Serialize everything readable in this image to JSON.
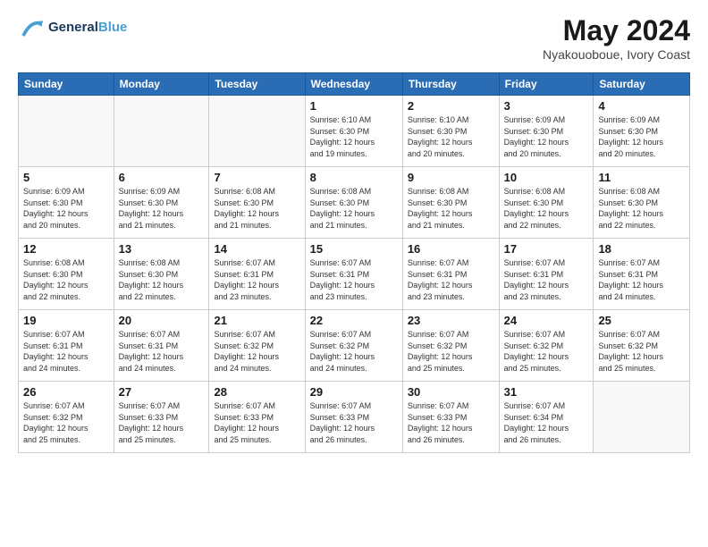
{
  "header": {
    "logo_line1": "General",
    "logo_line2": "Blue",
    "month_title": "May 2024",
    "location": "Nyakouoboue, Ivory Coast"
  },
  "weekdays": [
    "Sunday",
    "Monday",
    "Tuesday",
    "Wednesday",
    "Thursday",
    "Friday",
    "Saturday"
  ],
  "weeks": [
    [
      {
        "day": "",
        "info": ""
      },
      {
        "day": "",
        "info": ""
      },
      {
        "day": "",
        "info": ""
      },
      {
        "day": "1",
        "info": "Sunrise: 6:10 AM\nSunset: 6:30 PM\nDaylight: 12 hours\nand 19 minutes."
      },
      {
        "day": "2",
        "info": "Sunrise: 6:10 AM\nSunset: 6:30 PM\nDaylight: 12 hours\nand 20 minutes."
      },
      {
        "day": "3",
        "info": "Sunrise: 6:09 AM\nSunset: 6:30 PM\nDaylight: 12 hours\nand 20 minutes."
      },
      {
        "day": "4",
        "info": "Sunrise: 6:09 AM\nSunset: 6:30 PM\nDaylight: 12 hours\nand 20 minutes."
      }
    ],
    [
      {
        "day": "5",
        "info": "Sunrise: 6:09 AM\nSunset: 6:30 PM\nDaylight: 12 hours\nand 20 minutes."
      },
      {
        "day": "6",
        "info": "Sunrise: 6:09 AM\nSunset: 6:30 PM\nDaylight: 12 hours\nand 21 minutes."
      },
      {
        "day": "7",
        "info": "Sunrise: 6:08 AM\nSunset: 6:30 PM\nDaylight: 12 hours\nand 21 minutes."
      },
      {
        "day": "8",
        "info": "Sunrise: 6:08 AM\nSunset: 6:30 PM\nDaylight: 12 hours\nand 21 minutes."
      },
      {
        "day": "9",
        "info": "Sunrise: 6:08 AM\nSunset: 6:30 PM\nDaylight: 12 hours\nand 21 minutes."
      },
      {
        "day": "10",
        "info": "Sunrise: 6:08 AM\nSunset: 6:30 PM\nDaylight: 12 hours\nand 22 minutes."
      },
      {
        "day": "11",
        "info": "Sunrise: 6:08 AM\nSunset: 6:30 PM\nDaylight: 12 hours\nand 22 minutes."
      }
    ],
    [
      {
        "day": "12",
        "info": "Sunrise: 6:08 AM\nSunset: 6:30 PM\nDaylight: 12 hours\nand 22 minutes."
      },
      {
        "day": "13",
        "info": "Sunrise: 6:08 AM\nSunset: 6:30 PM\nDaylight: 12 hours\nand 22 minutes."
      },
      {
        "day": "14",
        "info": "Sunrise: 6:07 AM\nSunset: 6:31 PM\nDaylight: 12 hours\nand 23 minutes."
      },
      {
        "day": "15",
        "info": "Sunrise: 6:07 AM\nSunset: 6:31 PM\nDaylight: 12 hours\nand 23 minutes."
      },
      {
        "day": "16",
        "info": "Sunrise: 6:07 AM\nSunset: 6:31 PM\nDaylight: 12 hours\nand 23 minutes."
      },
      {
        "day": "17",
        "info": "Sunrise: 6:07 AM\nSunset: 6:31 PM\nDaylight: 12 hours\nand 23 minutes."
      },
      {
        "day": "18",
        "info": "Sunrise: 6:07 AM\nSunset: 6:31 PM\nDaylight: 12 hours\nand 24 minutes."
      }
    ],
    [
      {
        "day": "19",
        "info": "Sunrise: 6:07 AM\nSunset: 6:31 PM\nDaylight: 12 hours\nand 24 minutes."
      },
      {
        "day": "20",
        "info": "Sunrise: 6:07 AM\nSunset: 6:31 PM\nDaylight: 12 hours\nand 24 minutes."
      },
      {
        "day": "21",
        "info": "Sunrise: 6:07 AM\nSunset: 6:32 PM\nDaylight: 12 hours\nand 24 minutes."
      },
      {
        "day": "22",
        "info": "Sunrise: 6:07 AM\nSunset: 6:32 PM\nDaylight: 12 hours\nand 24 minutes."
      },
      {
        "day": "23",
        "info": "Sunrise: 6:07 AM\nSunset: 6:32 PM\nDaylight: 12 hours\nand 25 minutes."
      },
      {
        "day": "24",
        "info": "Sunrise: 6:07 AM\nSunset: 6:32 PM\nDaylight: 12 hours\nand 25 minutes."
      },
      {
        "day": "25",
        "info": "Sunrise: 6:07 AM\nSunset: 6:32 PM\nDaylight: 12 hours\nand 25 minutes."
      }
    ],
    [
      {
        "day": "26",
        "info": "Sunrise: 6:07 AM\nSunset: 6:32 PM\nDaylight: 12 hours\nand 25 minutes."
      },
      {
        "day": "27",
        "info": "Sunrise: 6:07 AM\nSunset: 6:33 PM\nDaylight: 12 hours\nand 25 minutes."
      },
      {
        "day": "28",
        "info": "Sunrise: 6:07 AM\nSunset: 6:33 PM\nDaylight: 12 hours\nand 25 minutes."
      },
      {
        "day": "29",
        "info": "Sunrise: 6:07 AM\nSunset: 6:33 PM\nDaylight: 12 hours\nand 26 minutes."
      },
      {
        "day": "30",
        "info": "Sunrise: 6:07 AM\nSunset: 6:33 PM\nDaylight: 12 hours\nand 26 minutes."
      },
      {
        "day": "31",
        "info": "Sunrise: 6:07 AM\nSunset: 6:34 PM\nDaylight: 12 hours\nand 26 minutes."
      },
      {
        "day": "",
        "info": ""
      }
    ]
  ]
}
